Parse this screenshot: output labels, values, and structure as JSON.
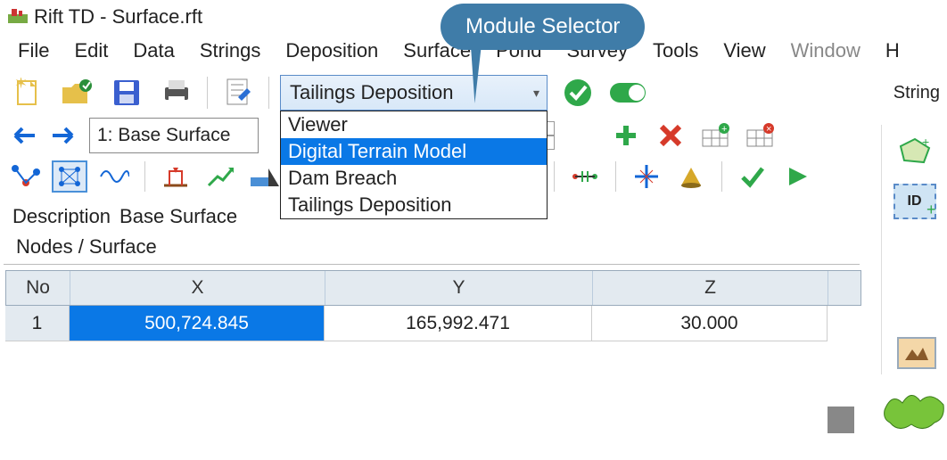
{
  "title": "Rift TD - Surface.rft",
  "callout": "Module Selector",
  "menu": [
    "File",
    "Edit",
    "Data",
    "Strings",
    "Deposition",
    "Surface",
    "Pond",
    "Survey",
    "Tools",
    "View",
    "Window",
    "H"
  ],
  "module_selector": {
    "selected": "Tailings Deposition",
    "options": [
      "Viewer",
      "Digital Terrain Model",
      "Dam Breach",
      "Tailings Deposition"
    ],
    "highlighted_index": 1
  },
  "surface_selector": "1: Base Surface",
  "right_label": "String",
  "description_label": "Description",
  "description_value": "Base Surface",
  "tab_label": "Nodes / Surface",
  "grid": {
    "headers": [
      "No",
      "X",
      "Y",
      "Z"
    ],
    "rows": [
      {
        "no": "1",
        "x": "500,724.845",
        "y": "165,992.471",
        "z": "30.000"
      }
    ]
  },
  "id_badge": "ID",
  "toolbar_icons": {
    "new": "new-file",
    "open": "open-folder",
    "save": "save",
    "print": "print",
    "edit": "edit-note",
    "ok": "check-circle",
    "toggle": "toggle-on",
    "back": "arrow-left",
    "fwd": "arrow-right",
    "plus": "plus",
    "x": "x-red",
    "grid-add": "grid-add",
    "grid-del": "grid-del",
    "poly": "polygon",
    "snap": "snap-grid",
    "wave": "waveform",
    "level": "level",
    "trend": "trend-up",
    "dam": "dam",
    "conn": "connector",
    "axis": "axis-snap",
    "cone": "cone",
    "check": "check-green",
    "play": "play-green",
    "shape": "shape-poly",
    "id": "id-badge",
    "surface": "surface-terrain"
  }
}
